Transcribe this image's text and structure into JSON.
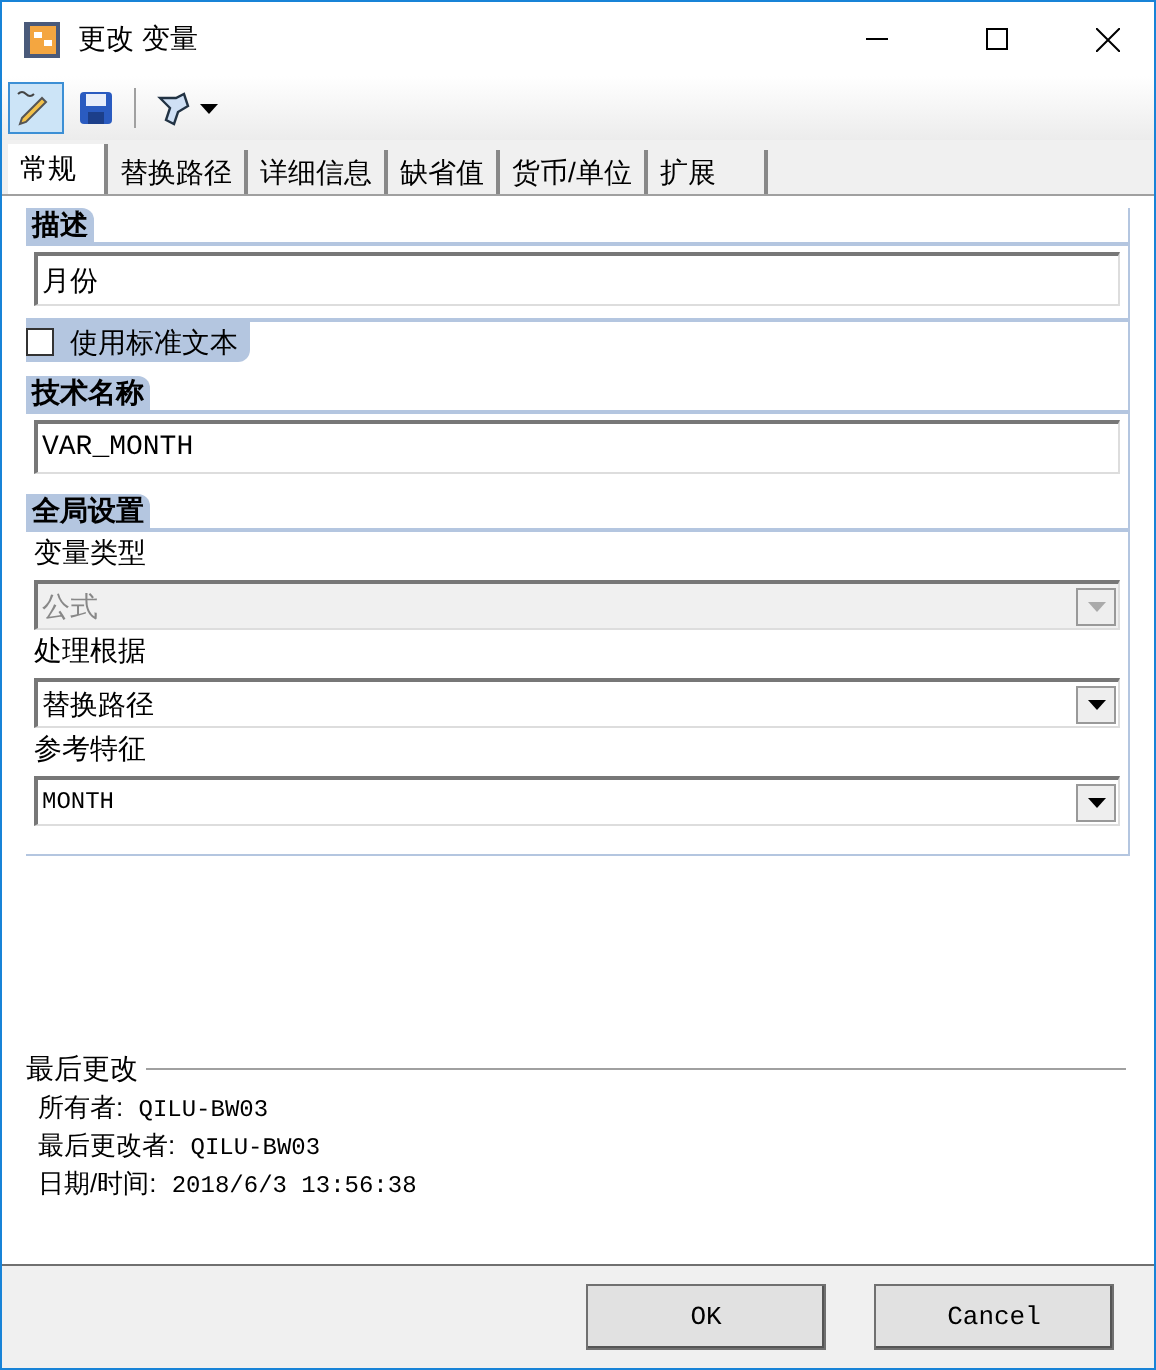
{
  "window": {
    "title": "更改 变量"
  },
  "toolbar": [
    {
      "kind": "edit",
      "selected": true
    },
    {
      "kind": "save",
      "selected": false
    },
    {
      "kind": "tools",
      "selected": false
    }
  ],
  "tabs": [
    {
      "label": "常规",
      "selected": true
    },
    {
      "label": "替换路径",
      "selected": false
    },
    {
      "label": "详细信息",
      "selected": false
    },
    {
      "label": "缺省值",
      "selected": false
    },
    {
      "label": "货币/单位",
      "selected": false
    },
    {
      "label": "扩展",
      "selected": false
    }
  ],
  "description": {
    "heading": "描述",
    "value": "月份"
  },
  "use_standard_text": {
    "label": "使用标准文本",
    "checked": false
  },
  "technical_name": {
    "heading": "技术名称",
    "value": "VAR_MONTH"
  },
  "global_settings": {
    "heading": "全局设置",
    "fields": [
      {
        "label": "变量类型",
        "value": "公式",
        "disabled": true,
        "mono": false
      },
      {
        "label": "处理根据",
        "value": "替换路径",
        "disabled": false,
        "mono": false
      },
      {
        "label": "参考特征",
        "value": "MONTH",
        "disabled": false,
        "mono": true
      }
    ]
  },
  "last_changed": {
    "heading": "最后更改",
    "lines": [
      {
        "label": "所有者:",
        "value": "QILU-BW03"
      },
      {
        "label": "最后更改者:",
        "value": "QILU-BW03"
      },
      {
        "label": "日期/时间:",
        "value": "2018/6/3 13:56:38"
      }
    ]
  },
  "buttons": [
    "OK",
    "Cancel"
  ]
}
